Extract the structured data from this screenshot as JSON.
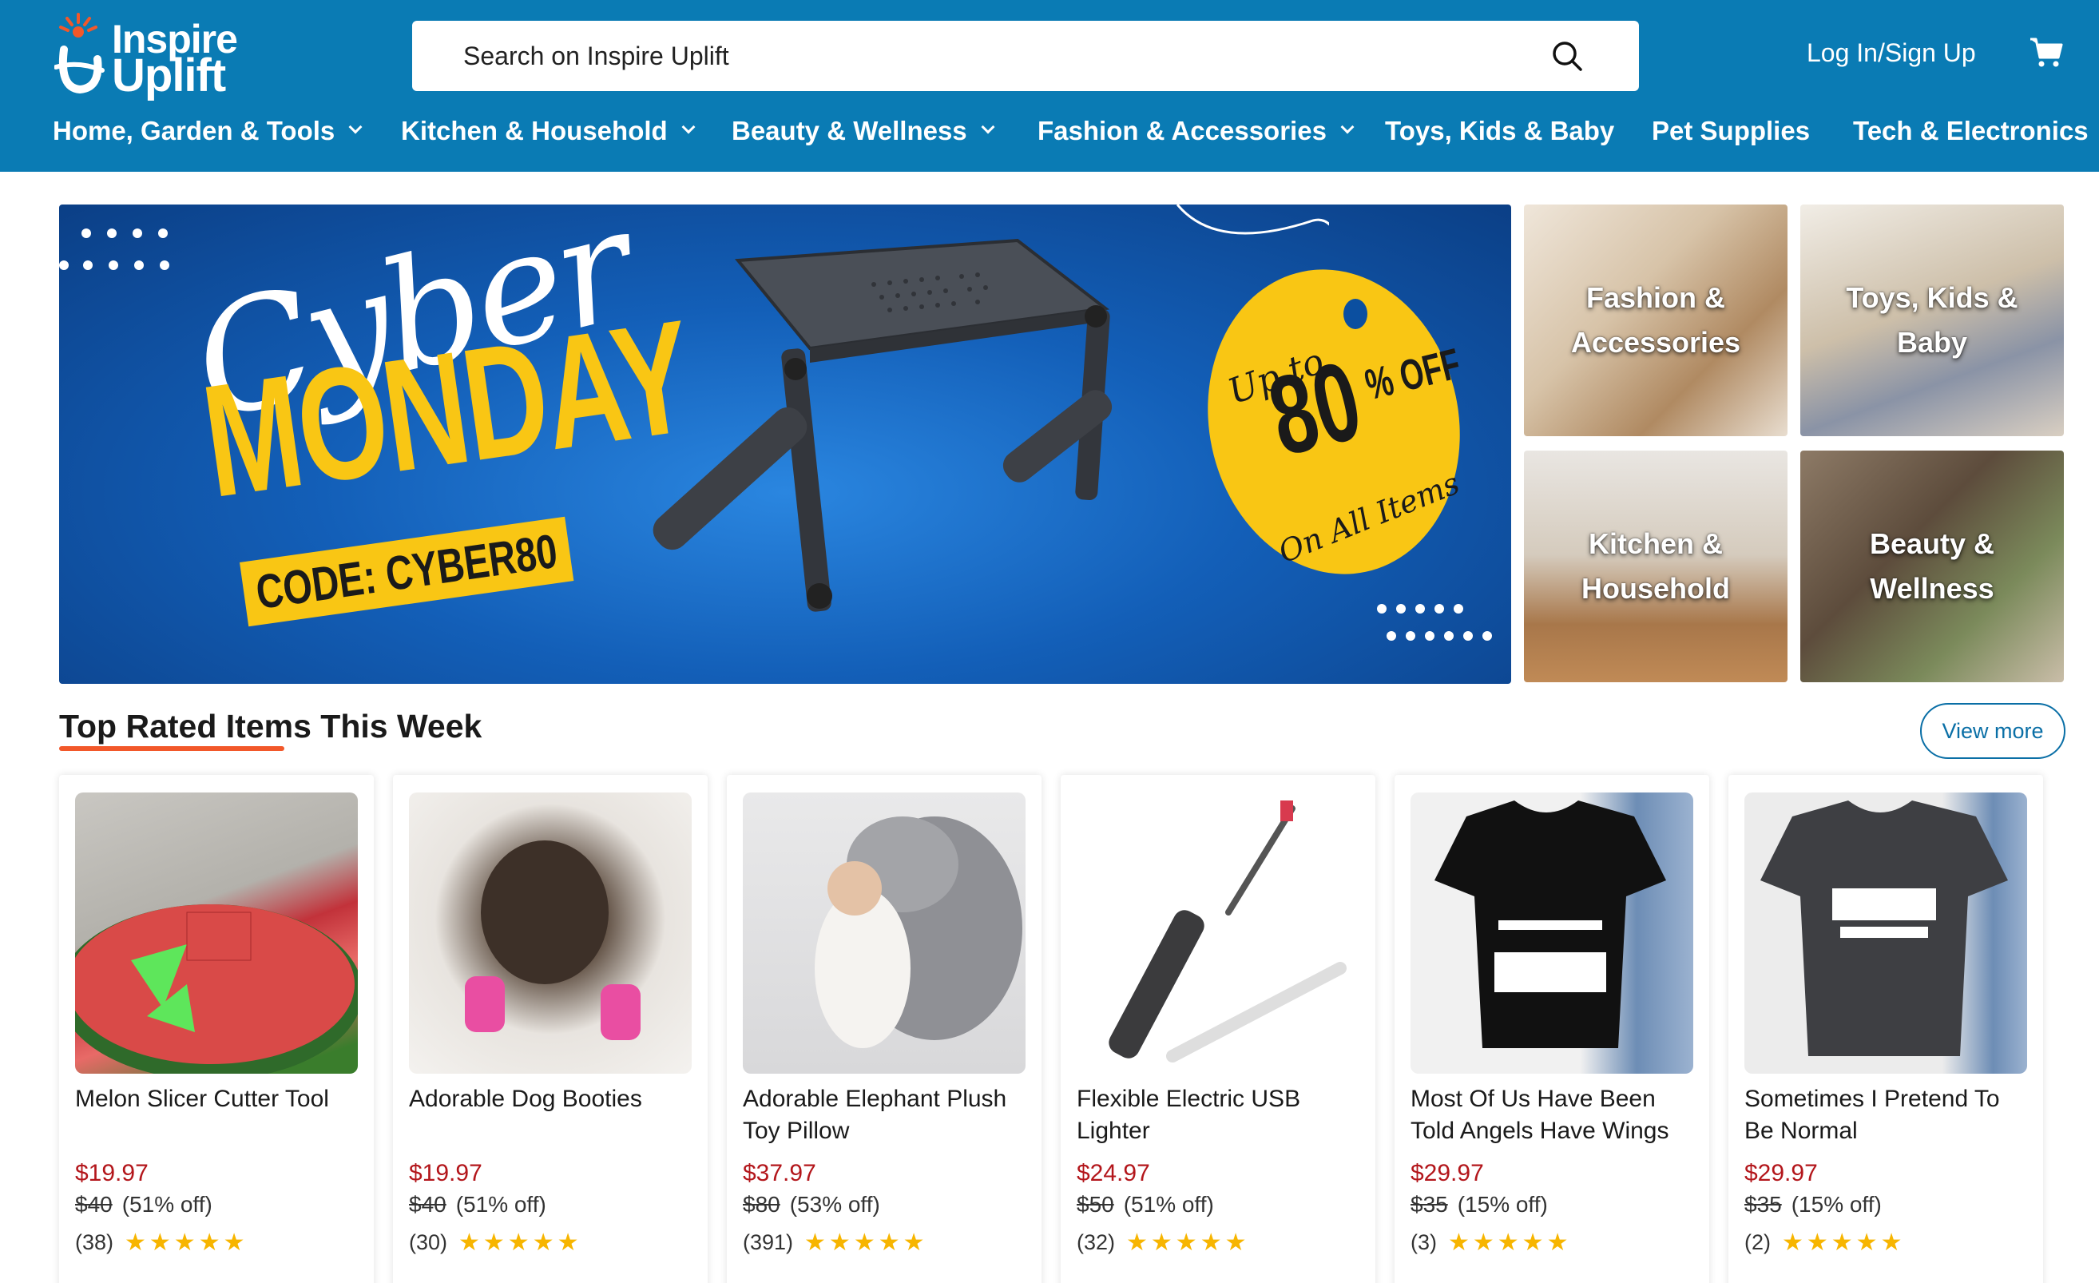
{
  "header": {
    "logo_line1": "Inspire",
    "logo_line2": "Uplift",
    "search_placeholder": "Search on Inspire Uplift",
    "login_label": "Log In/Sign Up",
    "cart_icon": "cart-icon",
    "search_icon": "search-icon"
  },
  "nav": {
    "items": [
      {
        "label": "Home, Garden & Tools",
        "dropdown": true
      },
      {
        "label": "Kitchen & Household",
        "dropdown": true
      },
      {
        "label": "Beauty & Wellness",
        "dropdown": true
      },
      {
        "label": "Fashion & Accessories",
        "dropdown": true
      },
      {
        "label": "Toys, Kids & Baby",
        "dropdown": false
      },
      {
        "label": "Pet Supplies",
        "dropdown": false
      },
      {
        "label": "Tech & Electronics",
        "dropdown": false
      }
    ]
  },
  "hero": {
    "cyber": "Cyber",
    "monday": "MONDAY",
    "code": "CODE: CYBER80",
    "tag_upto": "Up to",
    "tag_percent": "80",
    "tag_off": "% OFF",
    "tag_all": "On All Items"
  },
  "tiles": [
    {
      "label": "Fashion & Accessories"
    },
    {
      "label": "Toys, Kids & Baby"
    },
    {
      "label": "Kitchen & Household"
    },
    {
      "label": "Beauty & Wellness"
    }
  ],
  "section": {
    "title": "Top Rated Items This Week",
    "view_more": "View more"
  },
  "products": [
    {
      "title": "Melon Slicer Cutter Tool",
      "price": "$19.97",
      "old_price": "$40",
      "discount": "(51% off)",
      "reviews": "(38)",
      "rating": 5
    },
    {
      "title": "Adorable Dog Booties",
      "price": "$19.97",
      "old_price": "$40",
      "discount": "(51% off)",
      "reviews": "(30)",
      "rating": 5
    },
    {
      "title": "Adorable Elephant Plush Toy Pillow",
      "price": "$37.97",
      "old_price": "$80",
      "discount": "(53% off)",
      "reviews": "(391)",
      "rating": 5
    },
    {
      "title": "Flexible Electric USB Lighter",
      "price": "$24.97",
      "old_price": "$50",
      "discount": "(51% off)",
      "reviews": "(32)",
      "rating": 5
    },
    {
      "title": "Most Of Us Have Been Told Angels Have Wings",
      "price": "$29.97",
      "old_price": "$35",
      "discount": "(15% off)",
      "reviews": "(3)",
      "rating": 5
    },
    {
      "title": "Sometimes I Pretend To Be Normal",
      "price": "$29.97",
      "old_price": "$35",
      "discount": "(15% off)",
      "reviews": "(2)",
      "rating": 5
    }
  ],
  "colors": {
    "brand_blue": "#0a7bb4",
    "hero_yellow": "#f9c614",
    "price_red": "#b3161b",
    "accent_orange": "#f2582a",
    "star": "#f7b500"
  }
}
